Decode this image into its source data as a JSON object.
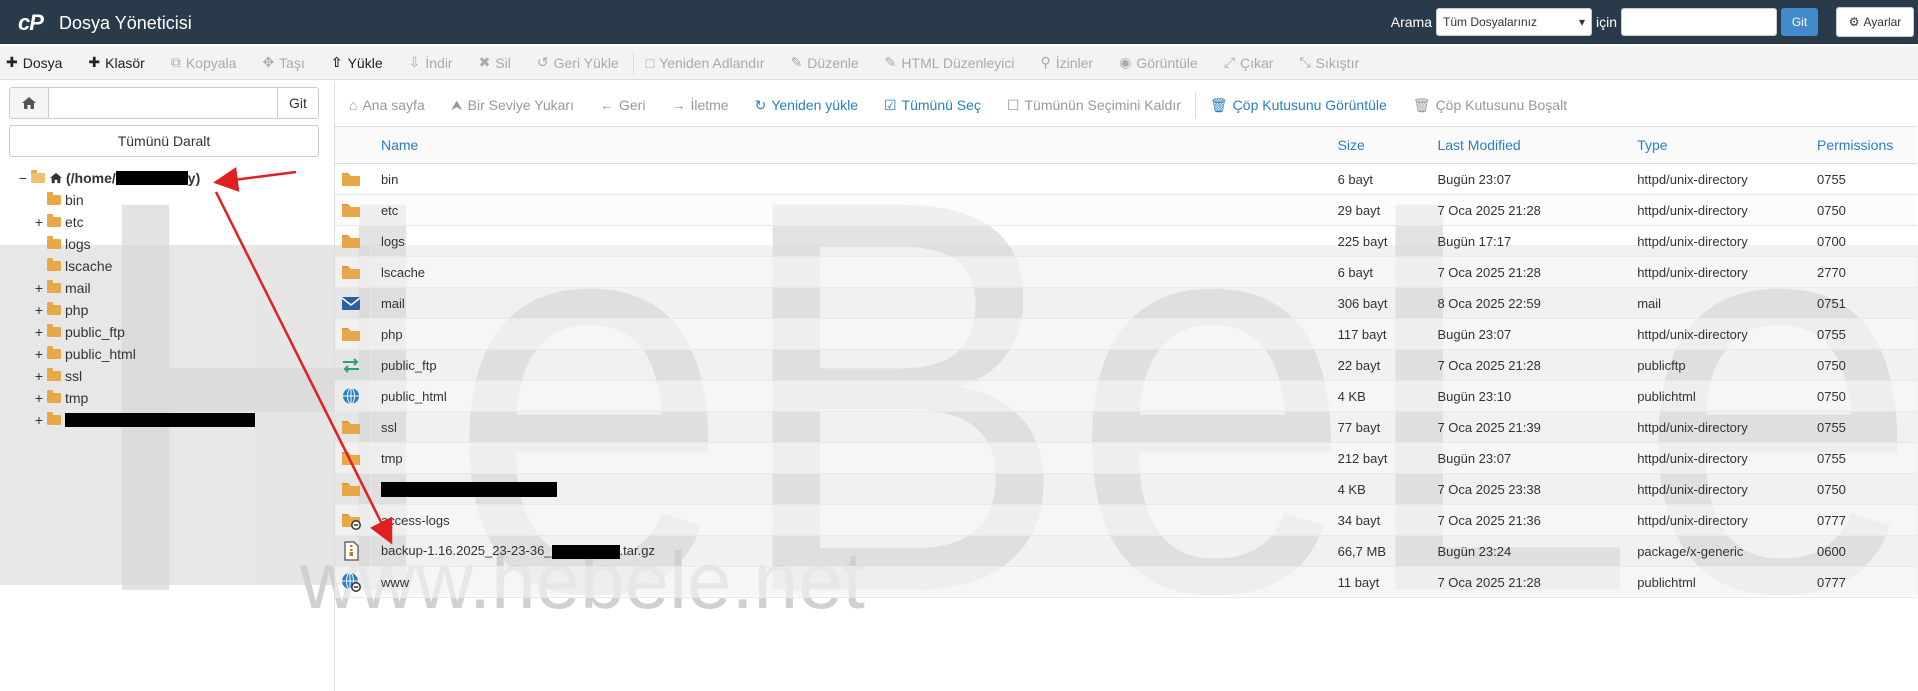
{
  "header": {
    "logo": "cP",
    "title": "Dosya Yöneticisi",
    "search_label": "Arama",
    "search_scope": "Tüm Dosyalarınız",
    "for_label": "için",
    "go_label": "Git",
    "settings_label": "Ayarlar"
  },
  "toolbar": [
    {
      "label": "Dosya",
      "icon": "plus-icon",
      "active": true
    },
    {
      "label": "Klasör",
      "icon": "plus-icon",
      "active": true
    },
    {
      "label": "Kopyala",
      "icon": "copy-icon",
      "active": false
    },
    {
      "label": "Taşı",
      "icon": "move-icon",
      "active": false
    },
    {
      "label": "Yükle",
      "icon": "upload-icon",
      "active": true
    },
    {
      "label": "İndir",
      "icon": "download-icon",
      "active": false
    },
    {
      "label": "Sil",
      "icon": "delete-icon",
      "active": false
    },
    {
      "label": "Geri Yükle",
      "icon": "undo-icon",
      "active": false
    },
    {
      "label": "Yeniden Adlandır",
      "icon": "rename-icon",
      "active": false
    },
    {
      "label": "Düzenle",
      "icon": "pencil-icon",
      "active": false
    },
    {
      "label": "HTML Düzenleyici",
      "icon": "html-editor-icon",
      "active": false
    },
    {
      "label": "İzinler",
      "icon": "key-icon",
      "active": false
    },
    {
      "label": "Görüntüle",
      "icon": "eye-icon",
      "active": false
    },
    {
      "label": "Çıkar",
      "icon": "expand-icon",
      "active": false
    },
    {
      "label": "Sıkıştır",
      "icon": "compress-icon",
      "active": false
    }
  ],
  "left": {
    "go_label": "Git",
    "collapse_label": "Tümünü Daralt",
    "root_label": "(/home/",
    "root_suffix": "y)",
    "tree": [
      {
        "label": "bin",
        "expandable": false
      },
      {
        "label": "etc",
        "expandable": true
      },
      {
        "label": "logs",
        "expandable": false
      },
      {
        "label": "lscache",
        "expandable": false
      },
      {
        "label": "mail",
        "expandable": true
      },
      {
        "label": "php",
        "expandable": true
      },
      {
        "label": "public_ftp",
        "expandable": true
      },
      {
        "label": "public_html",
        "expandable": true
      },
      {
        "label": "ssl",
        "expandable": true
      },
      {
        "label": "tmp",
        "expandable": true
      }
    ]
  },
  "nav": [
    {
      "label": "Ana sayfa",
      "icon": "home-icon",
      "blue": false
    },
    {
      "label": "Bir Seviye Yukarı",
      "icon": "level-up-icon",
      "blue": false
    },
    {
      "label": "Geri",
      "icon": "arrow-left-icon",
      "blue": false
    },
    {
      "label": "İletme",
      "icon": "arrow-right-icon",
      "blue": false
    },
    {
      "label": "Yeniden yükle",
      "icon": "refresh-icon",
      "blue": true
    },
    {
      "label": "Tümünü Seç",
      "icon": "checkbox-checked-icon",
      "blue": true
    },
    {
      "label": "Tümünün Seçimini Kaldır",
      "icon": "checkbox-icon",
      "blue": false
    },
    {
      "label": "Çöp Kutusunu Görüntüle",
      "icon": "trash-icon",
      "blue": true
    },
    {
      "label": "Çöp Kutusunu Boşalt",
      "icon": "trash-icon",
      "blue": false
    }
  ],
  "table": {
    "columns": [
      "Name",
      "Size",
      "Last Modified",
      "Type",
      "Permissions"
    ],
    "rows": [
      {
        "icon": "folder",
        "name": "bin",
        "size": "6 bayt",
        "modified": "Bugün 23:07",
        "type": "httpd/unix-directory",
        "perm": "0755"
      },
      {
        "icon": "folder",
        "name": "etc",
        "size": "29 bayt",
        "modified": "7 Oca 2025 21:28",
        "type": "httpd/unix-directory",
        "perm": "0750"
      },
      {
        "icon": "folder",
        "name": "logs",
        "size": "225 bayt",
        "modified": "Bugün 17:17",
        "type": "httpd/unix-directory",
        "perm": "0700"
      },
      {
        "icon": "folder",
        "name": "lscache",
        "size": "6 bayt",
        "modified": "7 Oca 2025 21:28",
        "type": "httpd/unix-directory",
        "perm": "2770"
      },
      {
        "icon": "mail",
        "name": "mail",
        "size": "306 bayt",
        "modified": "8 Oca 2025 22:59",
        "type": "mail",
        "perm": "0751"
      },
      {
        "icon": "folder",
        "name": "php",
        "size": "117 bayt",
        "modified": "Bugün 23:07",
        "type": "httpd/unix-directory",
        "perm": "0755"
      },
      {
        "icon": "ftp",
        "name": "public_ftp",
        "size": "22 bayt",
        "modified": "7 Oca 2025 21:28",
        "type": "publicftp",
        "perm": "0750"
      },
      {
        "icon": "globe",
        "name": "public_html",
        "size": "4 KB",
        "modified": "Bugün 23:10",
        "type": "publichtml",
        "perm": "0750"
      },
      {
        "icon": "folder",
        "name": "ssl",
        "size": "77 bayt",
        "modified": "7 Oca 2025 21:39",
        "type": "httpd/unix-directory",
        "perm": "0755"
      },
      {
        "icon": "folder",
        "name": "tmp",
        "size": "212 bayt",
        "modified": "Bugün 23:07",
        "type": "httpd/unix-directory",
        "perm": "0755"
      },
      {
        "icon": "folder",
        "name": "",
        "redacted": true,
        "size": "4 KB",
        "modified": "7 Oca 2025 23:38",
        "type": "httpd/unix-directory",
        "perm": "0750"
      },
      {
        "icon": "folder-link",
        "name": "access-logs",
        "size": "34 bayt",
        "modified": "7 Oca 2025 21:36",
        "type": "httpd/unix-directory",
        "perm": "0777"
      },
      {
        "icon": "archive",
        "name": "backup-1.16.2025_23-23-36_",
        "name_suffix": ".tar.gz",
        "redacted_part": true,
        "size": "66,7 MB",
        "modified": "Bugün 23:24",
        "type": "package/x-generic",
        "perm": "0600"
      },
      {
        "icon": "globe-link",
        "name": "www",
        "size": "11 bayt",
        "modified": "7 Oca 2025 21:28",
        "type": "publichtml",
        "perm": "0777"
      }
    ]
  },
  "watermark": {
    "text": "www.hebele.net",
    "big_text": "HeBeLe"
  },
  "colors": {
    "header_bg": "#293a4a",
    "link_blue": "#2a7fc1",
    "folder": "#e8a84a",
    "annotation_red": "#e02020"
  }
}
